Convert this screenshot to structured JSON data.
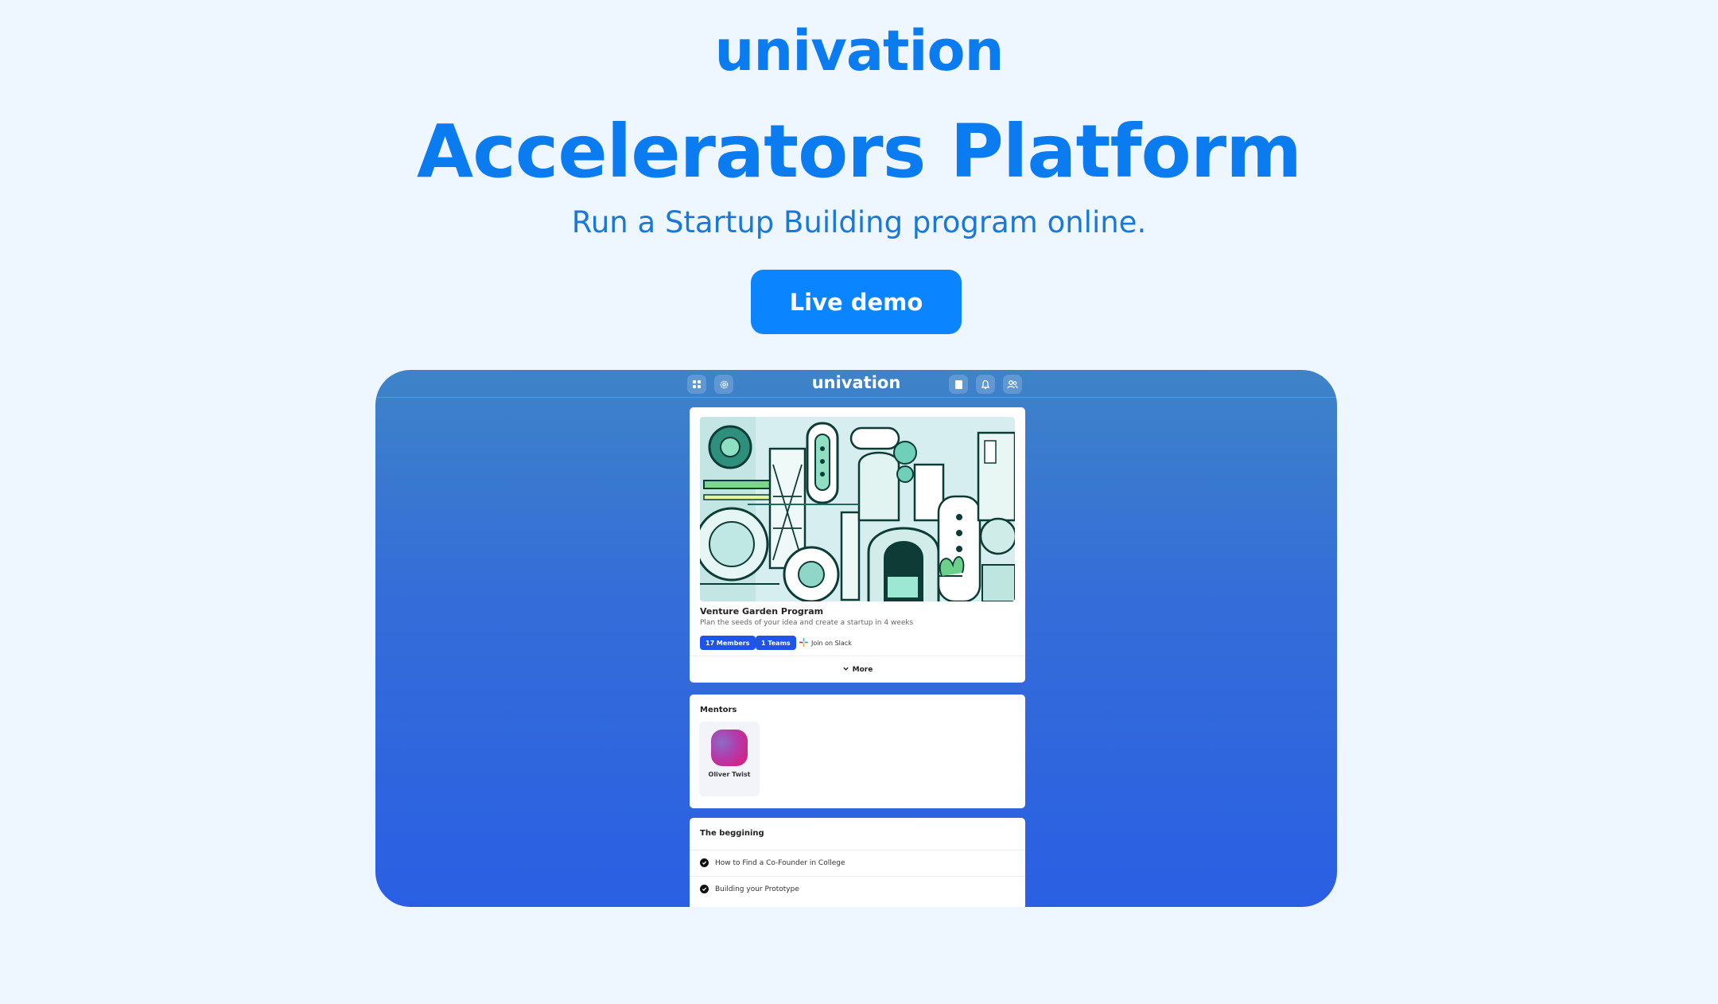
{
  "header": {
    "brand": "univation",
    "title": "Accelerators Platform",
    "subtitle": "Run a Startup Building program online.",
    "cta_label": "Live demo"
  },
  "demo": {
    "app_brand": "univation",
    "program": {
      "title": "Venture Garden Program",
      "description": "Plan the seeds of your idea and create a startup in 4 weeks",
      "members_badge": "17 Members",
      "teams_badge": "1 Teams",
      "slack_label": "Join on Slack",
      "more_label": "More"
    },
    "mentors": {
      "title": "Mentors",
      "items": [
        {
          "name": "Oliver Twist"
        }
      ]
    },
    "curriculum": {
      "title": "The beggining",
      "lessons": [
        {
          "label": "How to Find a Co-Founder in College"
        },
        {
          "label": "Building your Prototype"
        }
      ]
    }
  },
  "colors": {
    "page_bg": "#eef7ff",
    "brand_blue": "#0a7cf0",
    "cta_bg": "#0a84ff",
    "badge_blue": "#2053e8"
  }
}
